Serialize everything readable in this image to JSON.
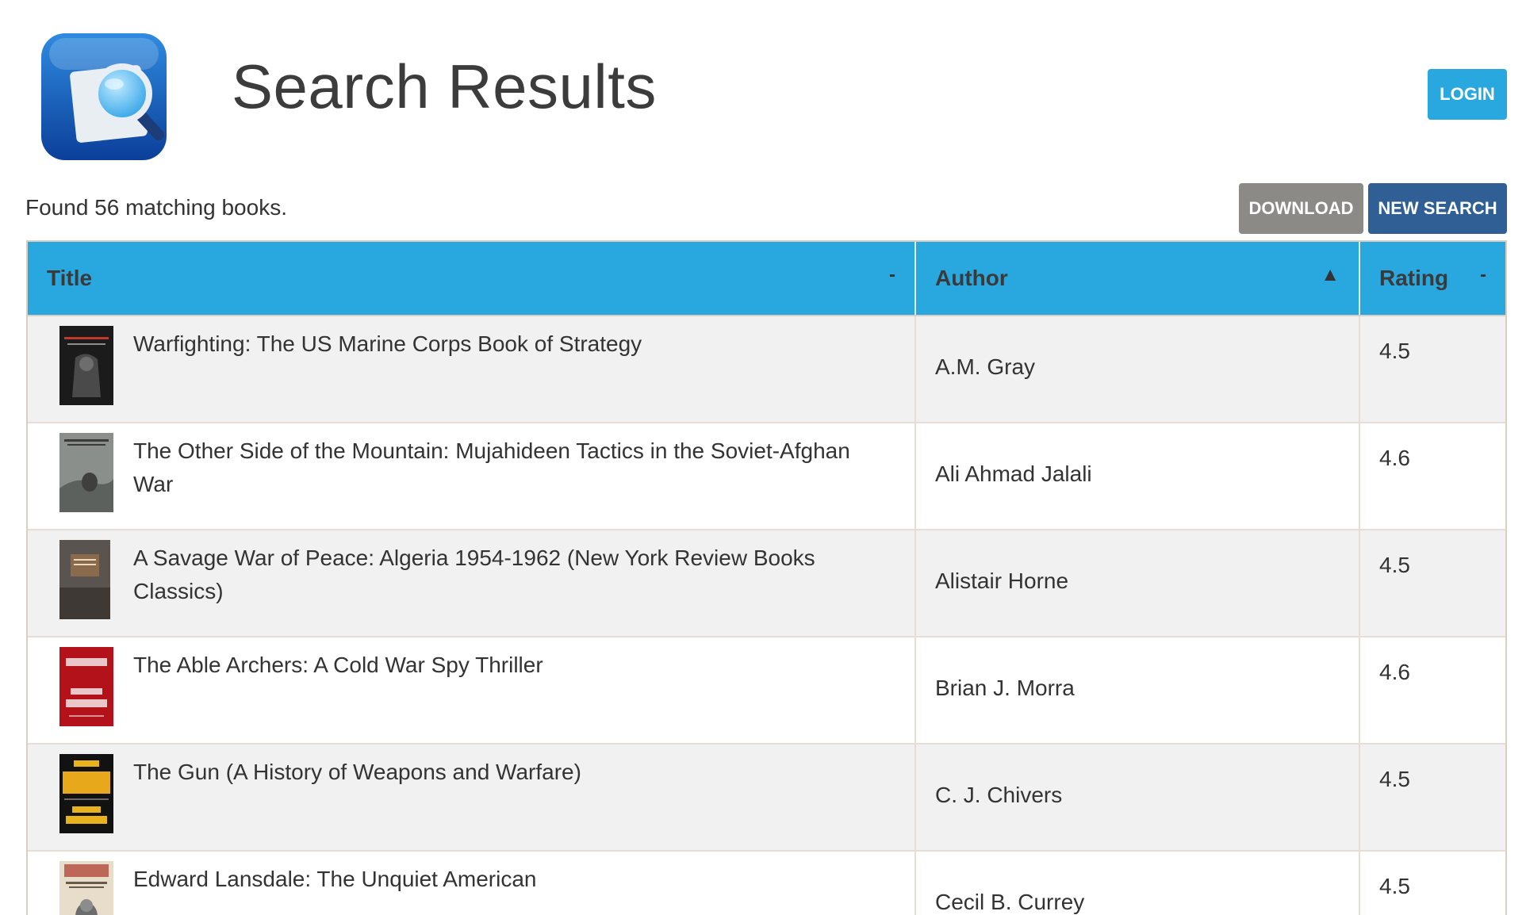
{
  "header": {
    "title": "Search Results",
    "login_label": "LOGIN"
  },
  "toolbar": {
    "results_count": "Found 56 matching books.",
    "download_label": "DOWNLOAD",
    "new_search_label": "NEW SEARCH"
  },
  "table": {
    "columns": [
      {
        "label": "Title",
        "sort": "-"
      },
      {
        "label": "Author",
        "sort": "▲"
      },
      {
        "label": "Rating",
        "sort": "-"
      }
    ],
    "rows": [
      {
        "title": "Warfighting: The US Marine Corps Book of Strategy",
        "author": "A.M. Gray",
        "rating": "4.5"
      },
      {
        "title": "The Other Side of the Mountain: Mujahideen Tactics in the Soviet-Afghan War",
        "author": "Ali Ahmad Jalali",
        "rating": "4.6"
      },
      {
        "title": "A Savage War of Peace: Algeria 1954-1962 (New York Review Books Classics)",
        "author": "Alistair Horne",
        "rating": "4.5"
      },
      {
        "title": "The Able Archers: A Cold War Spy Thriller",
        "author": "Brian J. Morra",
        "rating": "4.6"
      },
      {
        "title": "The Gun (A History of Weapons and Warfare)",
        "author": "C. J. Chivers",
        "rating": "4.5"
      },
      {
        "title": "Edward Lansdale: The Unquiet American",
        "author": "Cecil B. Currey",
        "rating": "4.5"
      }
    ]
  },
  "colors": {
    "header_bg": "#29a8e0",
    "login_bg": "#29a8e0",
    "download_bg": "#8c8a86",
    "new_search_bg": "#2f5f94",
    "row_stripe": "#f1f1f1"
  },
  "icons": {
    "app_logo": "document-magnifier-icon"
  }
}
